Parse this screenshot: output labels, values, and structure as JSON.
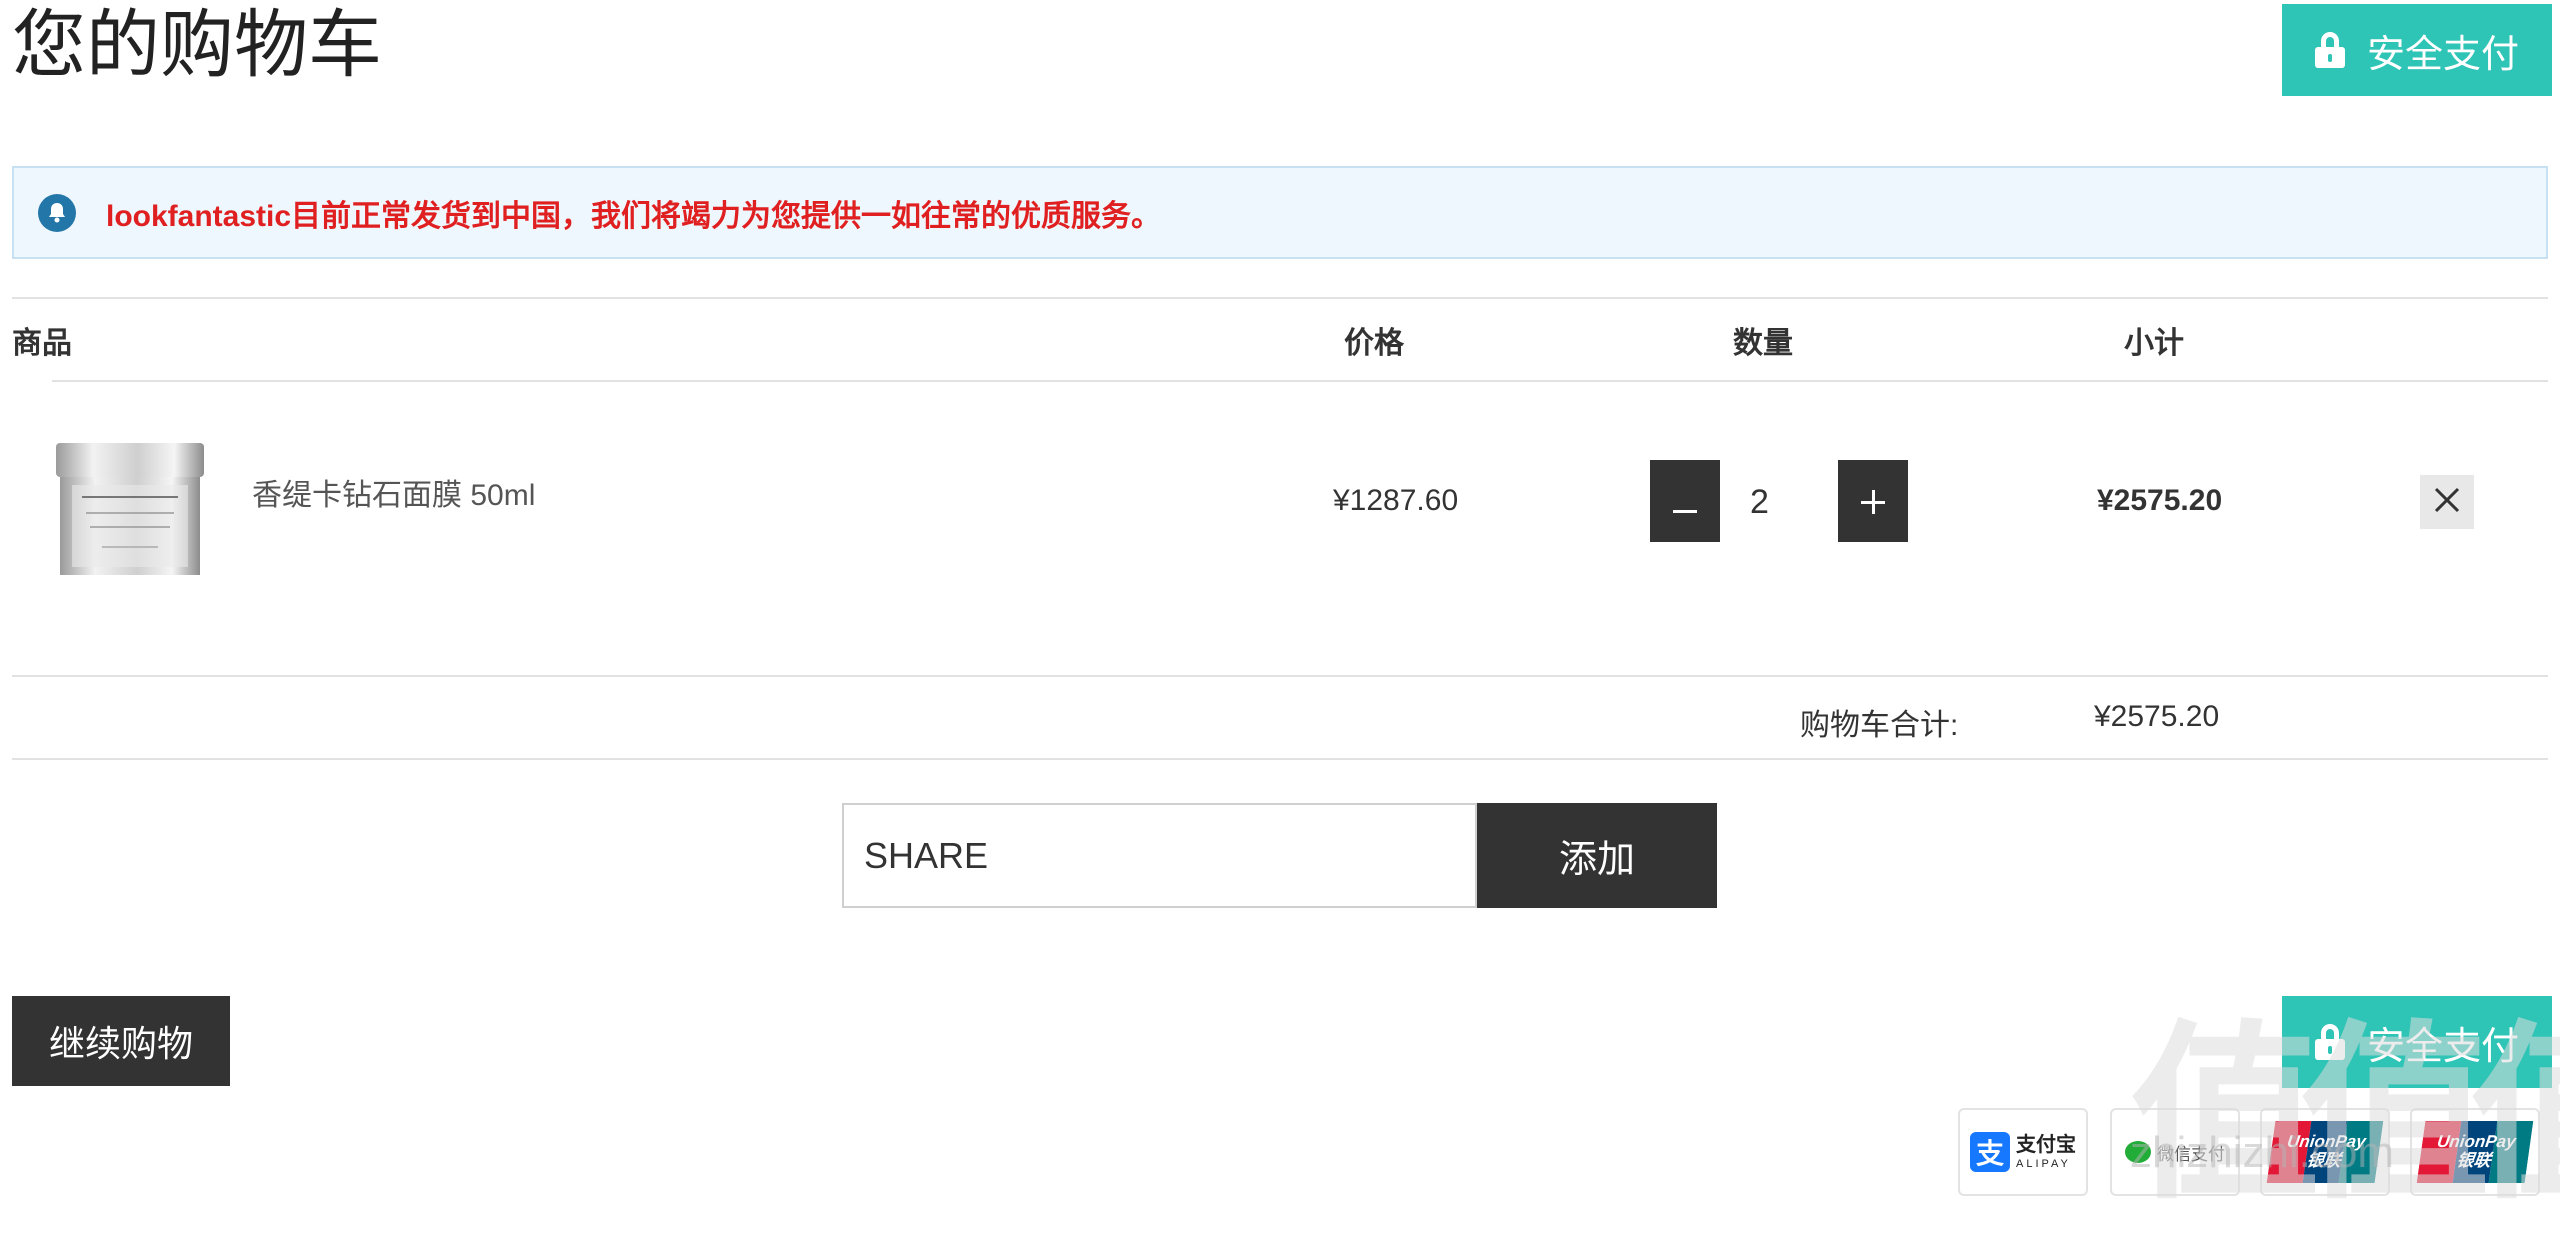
{
  "header": {
    "title": "您的购物车",
    "secure_checkout_label": "安全支付"
  },
  "notice": {
    "icon": "bell-icon",
    "text": "lookfantastic目前正常发货到中国，我们将竭力为您提供一如往常的优质服务。",
    "color": "#e02020"
  },
  "table": {
    "columns": [
      "商品",
      "价格",
      "数量",
      "小计"
    ]
  },
  "items": [
    {
      "name": "香缇卡钻石面膜 50ml",
      "price": "¥1287.60",
      "quantity": "2",
      "subtotal": "¥2575.20"
    }
  ],
  "totals": {
    "label": "购物车合计:",
    "value": "¥2575.20"
  },
  "coupon": {
    "value": "SHARE",
    "add_label": "添加"
  },
  "footer": {
    "continue_label": "继续购物",
    "secure_checkout_label": "安全支付"
  },
  "payments": {
    "alipay_cn": "支付宝",
    "alipay_en": "ALIPAY",
    "wechat": "微信支付",
    "unionpay_en": "UnionPay",
    "unionpay_cn": "银联"
  },
  "watermark": {
    "text": "值值值",
    "url": "zhizhizhi.com"
  },
  "colors": {
    "accent": "#2ec4b6",
    "dark_button": "#333333",
    "notice_bg": "#eef7fd"
  }
}
